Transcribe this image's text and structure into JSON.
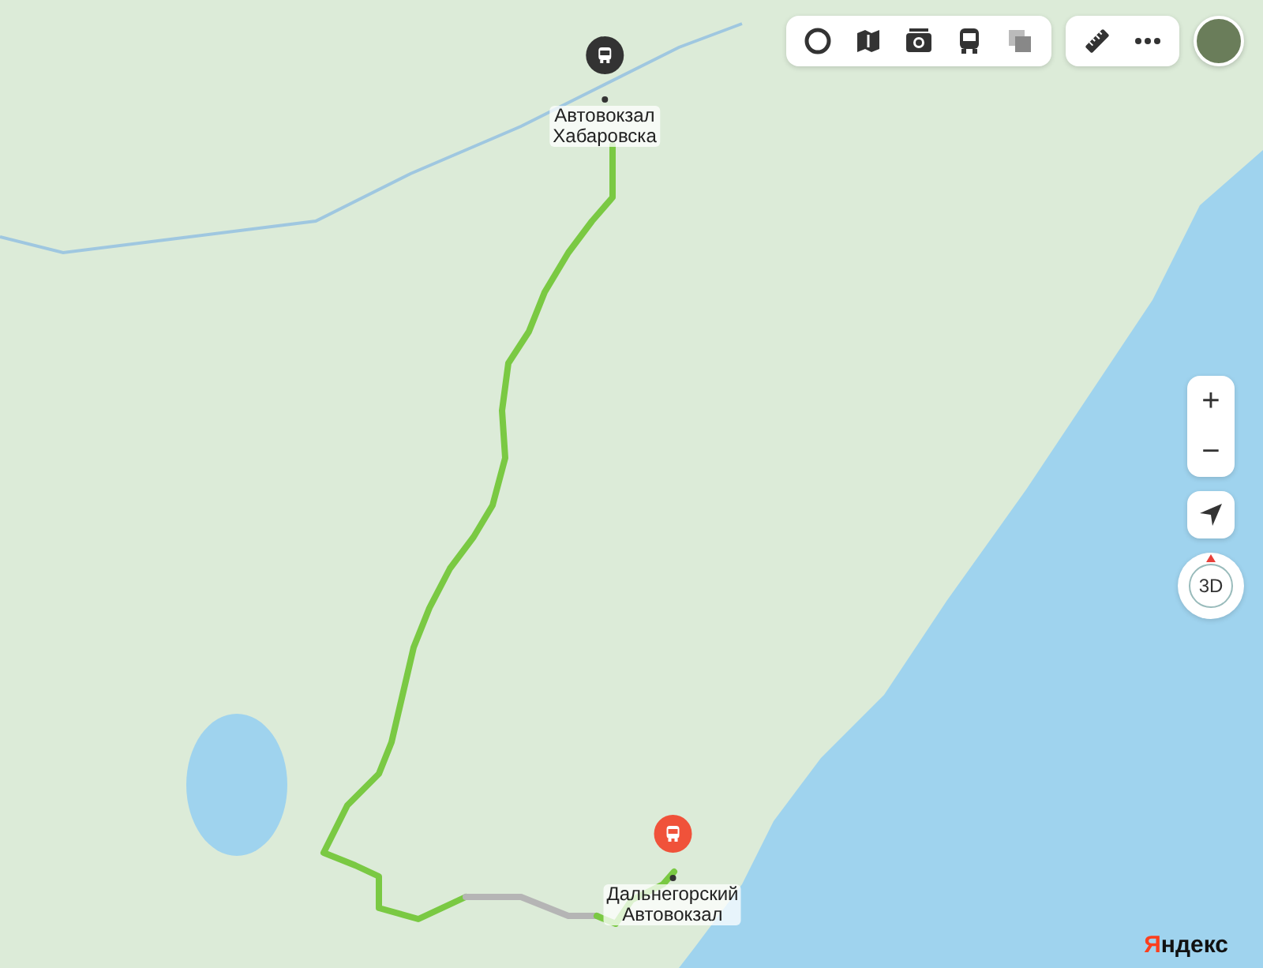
{
  "toolbar": {
    "avatar": true
  },
  "route": {
    "segments": [
      {
        "color": "#7ac943"
      },
      {
        "color": "#b5b5b5"
      },
      {
        "color": "#7ac943"
      }
    ],
    "markers": [
      {
        "kind": "start",
        "label": "Автовокзал Хабаровска",
        "color": "#333333"
      },
      {
        "kind": "end",
        "label": "Дальнегорский Автовокзал",
        "color": "#f0523a"
      }
    ]
  },
  "zoom_controls": [
    {
      "label": "+"
    },
    {
      "label": "−"
    }
  ],
  "compass": {
    "label": "3D"
  },
  "logo": {
    "text": "Яндекс"
  }
}
